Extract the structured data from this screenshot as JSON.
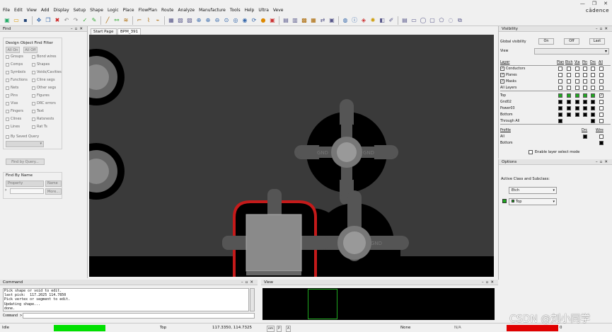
{
  "menu": [
    "File",
    "Edit",
    "View",
    "Add",
    "Display",
    "Setup",
    "Shape",
    "Logic",
    "Place",
    "FlowPlan",
    "Route",
    "Analyze",
    "Manufacture",
    "Tools",
    "Help",
    "Ultra",
    "Veve"
  ],
  "brand": "cādence",
  "find": {
    "title": "Find",
    "filter_title": "Design Object Find Filter",
    "all_on": "All On",
    "all_off": "All Off",
    "left_items": [
      "Groups",
      "Comps",
      "Symbols",
      "Functions",
      "Nets",
      "Pins",
      "Vias",
      "Fingers",
      "Clines",
      "Lines"
    ],
    "right_items": [
      "Bond wires",
      "Shapes",
      "Voids/Cavities",
      "Cline segs",
      "Other segs",
      "Figures",
      "DRC errors",
      "Text",
      "Ratsnests",
      "Rat Ts"
    ],
    "saved_query": "By Saved Query",
    "find_by_query": "Find by Query...",
    "find_by_name": "Find By Name",
    "property": "Property",
    "name": "Name",
    "more": "More..."
  },
  "tabs": [
    "Start Page",
    "BPM_391"
  ],
  "canvas_labels": {
    "gnd_left": "GND",
    "gnd_right": "GND",
    "gnd_bottom": "GND"
  },
  "visibility": {
    "title": "Visibility",
    "global": "Global visibility",
    "on": "On",
    "off": "Off",
    "last": "Last",
    "view_label": "View",
    "head_layer": "Layer",
    "cols": [
      "Plan",
      "Etch",
      "Via",
      "Pin",
      "Drc",
      "All"
    ],
    "groups": [
      "Conductors",
      "Planes",
      "Masks",
      "All Layers"
    ],
    "layers": [
      "Top",
      "Gnd02",
      "Power03",
      "Bottom",
      "Through All"
    ],
    "profile_head": "Profile",
    "profile_cols": [
      "Drc",
      "Wire"
    ],
    "profiles": [
      "All",
      "Bottom"
    ],
    "layer_select": "Enable layer select mode"
  },
  "options": {
    "title": "Options",
    "active": "Active Class and Subclass:",
    "class": "Etch",
    "subclass": "Top"
  },
  "command": {
    "title": "Command",
    "lines": [
      "Pick shape or void to edit.",
      "last pick:  117.2025 114.7850",
      "Pick vertex or segment to edit.",
      "Updating shape...",
      "done."
    ],
    "prompt": "Command >"
  },
  "view": {
    "title": "View"
  },
  "status": {
    "mode": "Idle",
    "layer": "Top",
    "coords": "117.3350, 114.7325",
    "p": "P",
    "a": "A",
    "om": "om",
    "none": "None",
    "na": "N/A",
    "drc": "0",
    "watermark": "CSDN @刘小同学"
  }
}
